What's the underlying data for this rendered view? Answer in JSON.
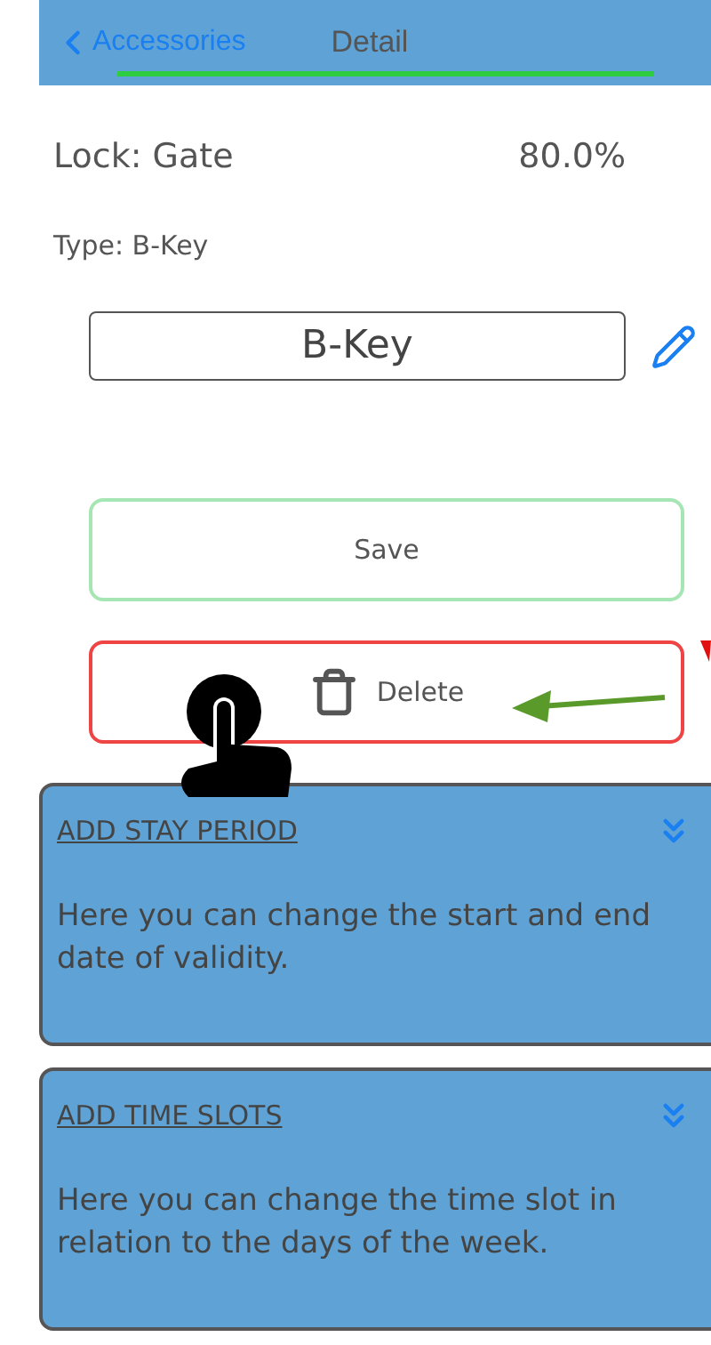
{
  "nav_bar": {
    "back_label": "Accessories",
    "title": "Detail"
  },
  "lock": {
    "label": "Lock: Gate",
    "value": "80.0%"
  },
  "type_label": "Type: B-Key",
  "name_field": {
    "value": "B-Key"
  },
  "buttons": [
    {
      "label": "Save",
      "kind": "save"
    },
    {
      "label": "Delete",
      "kind": "delete"
    }
  ],
  "sections": [
    {
      "title": "ADD STAY PERIOD",
      "description": "Here you can change the start and end date of validity.",
      "expanded": false
    },
    {
      "title": "ADD TIME SLOTS",
      "description": "Here you can change the time slot in relation to the days of the week.",
      "expanded": false
    }
  ]
}
